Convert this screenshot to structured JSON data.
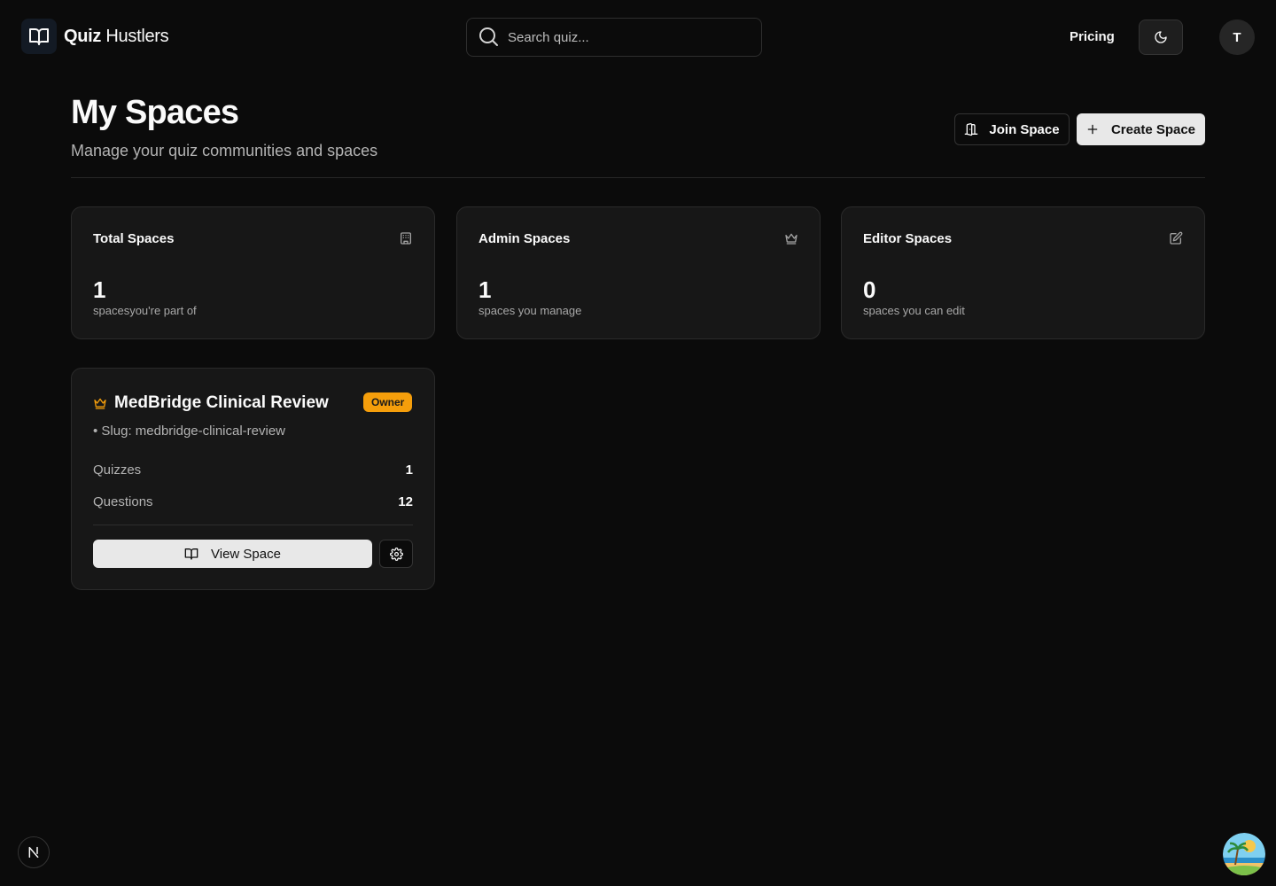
{
  "header": {
    "logo_bold": "Quiz",
    "logo_light": "Hustlers",
    "search_placeholder": "Search quiz...",
    "pricing_label": "Pricing",
    "avatar_initial": "T"
  },
  "page": {
    "title": "My Spaces",
    "subtitle": "Manage your quiz communities and spaces",
    "join_label": "Join Space",
    "create_label": "Create Space"
  },
  "stats": [
    {
      "title": "Total Spaces",
      "value": "1",
      "desc": "spacesyou're part of",
      "icon": "building-icon"
    },
    {
      "title": "Admin Spaces",
      "value": "1",
      "desc": "spaces you manage",
      "icon": "crown-icon"
    },
    {
      "title": "Editor Spaces",
      "value": "0",
      "desc": "spaces you can edit",
      "icon": "edit-icon"
    }
  ],
  "space": {
    "name": "MedBridge Clinical Review",
    "badge": "Owner",
    "slug": "• Slug: medbridge-clinical-review",
    "quizzes_label": "Quizzes",
    "quizzes_value": "1",
    "questions_label": "Questions",
    "questions_value": "12",
    "view_label": "View Space"
  },
  "colors": {
    "background": "#0b0b0b",
    "card": "#171717",
    "accent_owner": "#f59e0b",
    "button_light": "#e8e8e8"
  }
}
